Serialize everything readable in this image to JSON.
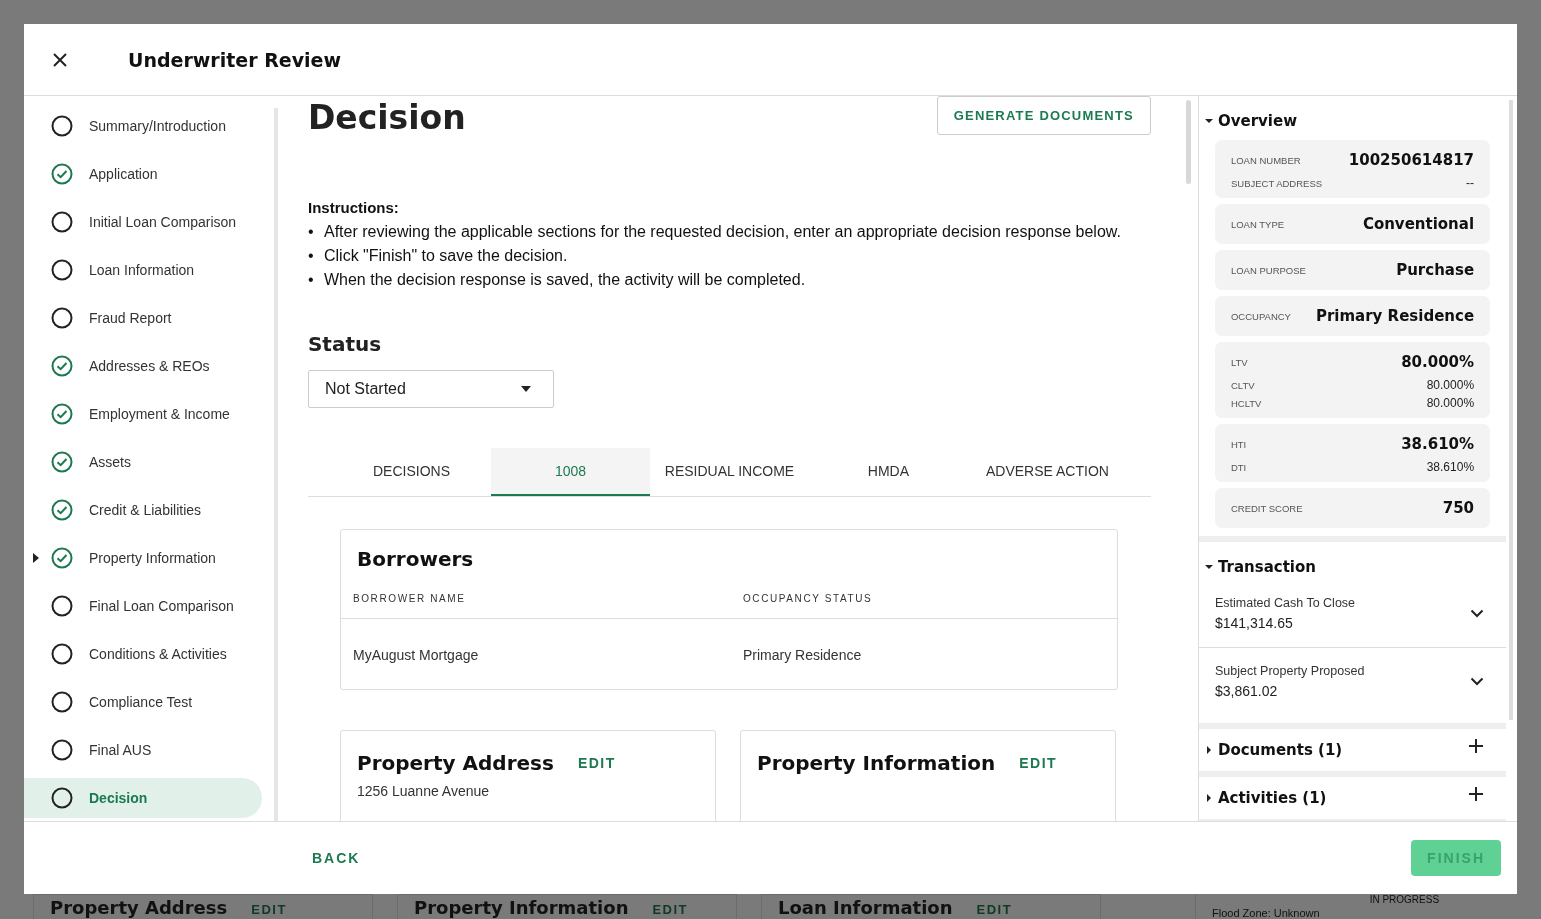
{
  "modal": {
    "title": "Underwriter Review"
  },
  "nav": [
    {
      "label": "Summary/Introduction",
      "completed": false,
      "selected": false,
      "expandable": false
    },
    {
      "label": "Application",
      "completed": true,
      "selected": false,
      "expandable": false
    },
    {
      "label": "Initial Loan Comparison",
      "completed": false,
      "selected": false,
      "expandable": false
    },
    {
      "label": "Loan Information",
      "completed": false,
      "selected": false,
      "expandable": false
    },
    {
      "label": "Fraud Report",
      "completed": false,
      "selected": false,
      "expandable": false
    },
    {
      "label": "Addresses & REOs",
      "completed": true,
      "selected": false,
      "expandable": false
    },
    {
      "label": "Employment & Income",
      "completed": true,
      "selected": false,
      "expandable": false
    },
    {
      "label": "Assets",
      "completed": true,
      "selected": false,
      "expandable": false
    },
    {
      "label": "Credit & Liabilities",
      "completed": true,
      "selected": false,
      "expandable": false
    },
    {
      "label": "Property Information",
      "completed": true,
      "selected": false,
      "expandable": true
    },
    {
      "label": "Final Loan Comparison",
      "completed": false,
      "selected": false,
      "expandable": false
    },
    {
      "label": "Conditions & Activities",
      "completed": false,
      "selected": false,
      "expandable": false
    },
    {
      "label": "Compliance Test",
      "completed": false,
      "selected": false,
      "expandable": false
    },
    {
      "label": "Final AUS",
      "completed": false,
      "selected": false,
      "expandable": false
    },
    {
      "label": "Decision",
      "completed": false,
      "selected": true,
      "expandable": false
    }
  ],
  "page": {
    "title": "Decision",
    "action": "GENERATE DOCUMENTS",
    "instructions_heading": "Instructions:",
    "instructions": [
      {
        "marker": "•",
        "text": "After reviewing the applicable sections for the requested decision, enter an appropriate decision response below."
      },
      {
        "marker": "•",
        "text": "Click \"Finish\" to save the decision."
      },
      {
        "marker": "•",
        "text": "When the decision response is saved, the activity will be completed."
      }
    ],
    "status_heading": "Status",
    "status_value": "Not Started",
    "tabs": [
      {
        "label": "DECISIONS",
        "selected": false
      },
      {
        "label": "1008",
        "selected": true
      },
      {
        "label": "RESIDUAL INCOME",
        "selected": false
      },
      {
        "label": "HMDA",
        "selected": false
      },
      {
        "label": "ADVERSE ACTION",
        "selected": false
      }
    ],
    "borrowers": {
      "title": "Borrowers",
      "columns": [
        "BORROWER NAME",
        "OCCUPANCY STATUS"
      ],
      "rows": [
        [
          "MyAugust Mortgage",
          "Primary Residence"
        ]
      ]
    },
    "cards": [
      {
        "title": "Property Address",
        "action": "EDIT",
        "lines": [
          "1256 Luanne Avenue"
        ]
      },
      {
        "title": "Property Information",
        "action": "EDIT"
      }
    ]
  },
  "overview": {
    "title": "Overview",
    "expanded": true,
    "groups": [
      {
        "rows": [
          {
            "label": "LOAN NUMBER",
            "value": "100250614817"
          },
          {
            "label": "SUBJECT ADDRESS",
            "value": "--"
          }
        ]
      },
      {
        "rows": [
          {
            "label": "LOAN TYPE",
            "value": "Conventional"
          }
        ]
      },
      {
        "rows": [
          {
            "label": "LOAN PURPOSE",
            "value": "Purchase"
          }
        ]
      },
      {
        "rows": [
          {
            "label": "OCCUPANCY",
            "value": "Primary Residence"
          }
        ]
      },
      {
        "rows": [
          {
            "label": "LTV",
            "value": "80.000%"
          },
          {
            "label": "CLTV",
            "value": "80.000%"
          },
          {
            "label": "HCLTV",
            "value": "80.000%"
          }
        ]
      },
      {
        "rows": [
          {
            "label": "HTI",
            "value": "38.610%"
          },
          {
            "label": "DTI",
            "value": "38.610%"
          }
        ]
      },
      {
        "rows": [
          {
            "label": "CREDIT SCORE",
            "value": "750"
          }
        ]
      }
    ]
  },
  "transaction": {
    "title": "Transaction",
    "expanded": true,
    "items": [
      {
        "label": "Estimated Cash To Close",
        "value": "$141,314.65"
      },
      {
        "label": "Subject Property Proposed",
        "value": "$3,861.02"
      }
    ]
  },
  "sections": [
    {
      "title": "Documents (1)",
      "expanded": false
    },
    {
      "title": "Activities (1)",
      "expanded": false
    }
  ],
  "footer": {
    "back": "BACK",
    "finish": "FINISH",
    "finish_disabled": true
  },
  "background": {
    "cards": [
      {
        "title": "Property Address",
        "action": "EDIT"
      },
      {
        "title": "Property Information",
        "action": "EDIT"
      },
      {
        "title": "Loan Information",
        "action": "EDIT"
      }
    ],
    "status": "IN PROGRESS",
    "note": "Flood Zone: Unknown"
  }
}
